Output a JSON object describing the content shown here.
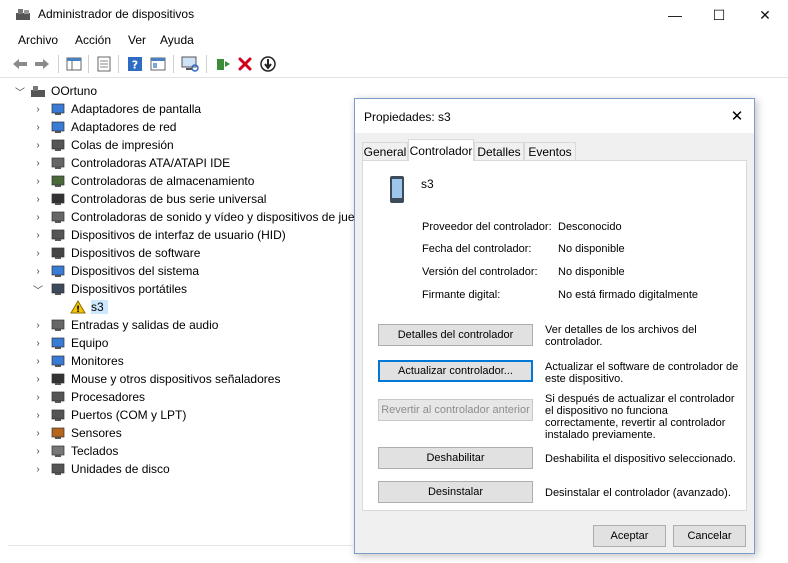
{
  "window": {
    "title": "Administrador de dispositivos",
    "controls": {
      "minimize": "—",
      "maximize": "☐",
      "close": "✕"
    }
  },
  "menu": [
    "Archivo",
    "Acción",
    "Ver",
    "Ayuda"
  ],
  "toolbar": {
    "icons": [
      "back-arrow-icon",
      "forward-arrow-icon",
      "show-hide-tree-icon",
      "properties-sheet-icon",
      "help-icon",
      "view-icon",
      "scan-hardware-icon",
      "update-driver-icon",
      "uninstall-icon",
      "disable-device-icon"
    ]
  },
  "tree": {
    "root": "OOrtuno",
    "items": [
      {
        "label": "Adaptadores de pantalla",
        "icon": "display-adapter-icon",
        "expanded": false
      },
      {
        "label": "Adaptadores de red",
        "icon": "network-adapter-icon",
        "expanded": false
      },
      {
        "label": "Colas de impresión",
        "icon": "printer-icon",
        "expanded": false
      },
      {
        "label": "Controladoras ATA/ATAPI IDE",
        "icon": "ide-controller-icon",
        "expanded": false
      },
      {
        "label": "Controladoras de almacenamiento",
        "icon": "storage-controller-icon",
        "expanded": false
      },
      {
        "label": "Controladoras de bus serie universal",
        "icon": "usb-icon",
        "expanded": false
      },
      {
        "label": "Controladoras de sonido y vídeo y dispositivos de jueg",
        "icon": "speaker-icon",
        "expanded": false
      },
      {
        "label": "Dispositivos de interfaz de usuario (HID)",
        "icon": "hid-icon",
        "expanded": false
      },
      {
        "label": "Dispositivos de software",
        "icon": "software-device-icon",
        "expanded": false
      },
      {
        "label": "Dispositivos del sistema",
        "icon": "system-device-icon",
        "expanded": false
      },
      {
        "label": "Dispositivos portátiles",
        "icon": "portable-device-icon",
        "expanded": true
      },
      {
        "label": "s3",
        "icon": "warning-icon",
        "child": true,
        "selected": true
      },
      {
        "label": "Entradas y salidas de audio",
        "icon": "speaker-icon",
        "expanded": false
      },
      {
        "label": "Equipo",
        "icon": "computer-icon",
        "expanded": false
      },
      {
        "label": "Monitores",
        "icon": "monitor-icon",
        "expanded": false
      },
      {
        "label": "Mouse y otros dispositivos señaladores",
        "icon": "mouse-icon",
        "expanded": false
      },
      {
        "label": "Procesadores",
        "icon": "processor-icon",
        "expanded": false
      },
      {
        "label": "Puertos (COM y LPT)",
        "icon": "port-icon",
        "expanded": false
      },
      {
        "label": "Sensores",
        "icon": "sensor-icon",
        "expanded": false
      },
      {
        "label": "Teclados",
        "icon": "keyboard-icon",
        "expanded": false
      },
      {
        "label": "Unidades de disco",
        "icon": "disk-drive-icon",
        "expanded": false
      }
    ]
  },
  "dialog": {
    "title": "Propiedades: s3",
    "close": "✕",
    "tabs": [
      "General",
      "Controlador",
      "Detalles",
      "Eventos"
    ],
    "active_tab": "Controlador",
    "device_name": "s3",
    "properties": [
      {
        "label": "Proveedor del controlador:",
        "value": "Desconocido"
      },
      {
        "label": "Fecha del controlador:",
        "value": "No disponible"
      },
      {
        "label": "Versión del controlador:",
        "value": "No disponible"
      },
      {
        "label": "Firmante digital:",
        "value": "No está firmado digitalmente"
      }
    ],
    "actions": [
      {
        "button": "Detalles del controlador",
        "description": "Ver detalles de los archivos del controlador.",
        "state": "normal"
      },
      {
        "button": "Actualizar controlador...",
        "description": "Actualizar el software de controlador de este dispositivo.",
        "state": "focused"
      },
      {
        "button": "Revertir al controlador anterior",
        "description": "Si después de actualizar el controlador el dispositivo no funciona correctamente, revertir al controlador instalado previamente.",
        "state": "disabled"
      },
      {
        "button": "Deshabilitar",
        "description": "Deshabilita el dispositivo seleccionado.",
        "state": "normal"
      },
      {
        "button": "Desinstalar",
        "description": "Desinstalar el controlador (avanzado).",
        "state": "normal"
      }
    ],
    "ok": "Aceptar",
    "cancel": "Cancelar"
  },
  "colors": {
    "selection": "#cce8ff",
    "accent": "#0078d7",
    "warning": "#f5c400",
    "delete_red": "#d0021b"
  }
}
